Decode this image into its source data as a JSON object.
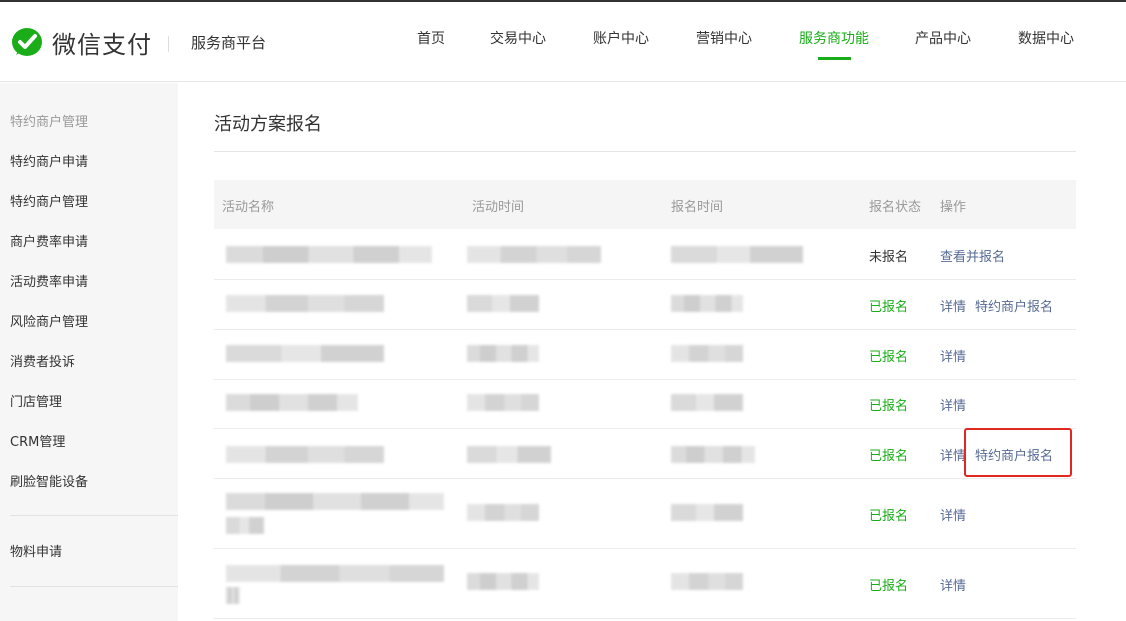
{
  "header": {
    "logo_text": "微信支付",
    "platform": "服务商平台",
    "nav": [
      "首页",
      "交易中心",
      "账户中心",
      "营销中心",
      "服务商功能",
      "产品中心",
      "数据中心"
    ],
    "active_nav": "服务商功能"
  },
  "sidebar": {
    "group_title": "特约商户管理",
    "items": [
      "特约商户申请",
      "特约商户管理",
      "商户费率申请",
      "活动费率申请",
      "风险商户管理",
      "消费者投诉",
      "门店管理",
      "CRM管理",
      "刷脸智能设备"
    ],
    "items2": [
      "物料申请"
    ]
  },
  "page": {
    "title": "活动方案报名"
  },
  "table": {
    "headers": [
      "活动名称",
      "活动时间",
      "报名时间",
      "报名状态",
      "操作"
    ],
    "rows": [
      {
        "status": "未报名",
        "ops": [
          "查看并报名"
        ]
      },
      {
        "status": "已报名",
        "ops": [
          "详情",
          "特约商户报名"
        ]
      },
      {
        "status": "已报名",
        "ops": [
          "详情"
        ]
      },
      {
        "status": "已报名",
        "ops": [
          "详情"
        ]
      },
      {
        "status": "已报名",
        "ops": [
          "详情",
          "特约商户报名"
        ]
      },
      {
        "status": "已报名",
        "ops": [
          "详情"
        ]
      },
      {
        "status": "已报名",
        "ops": [
          "详情"
        ]
      }
    ]
  },
  "colors": {
    "accent": "#1aad19",
    "link": "#576b95",
    "highlight": "#e0281e"
  },
  "icons": {
    "logo": "wechat-pay-check-icon"
  }
}
